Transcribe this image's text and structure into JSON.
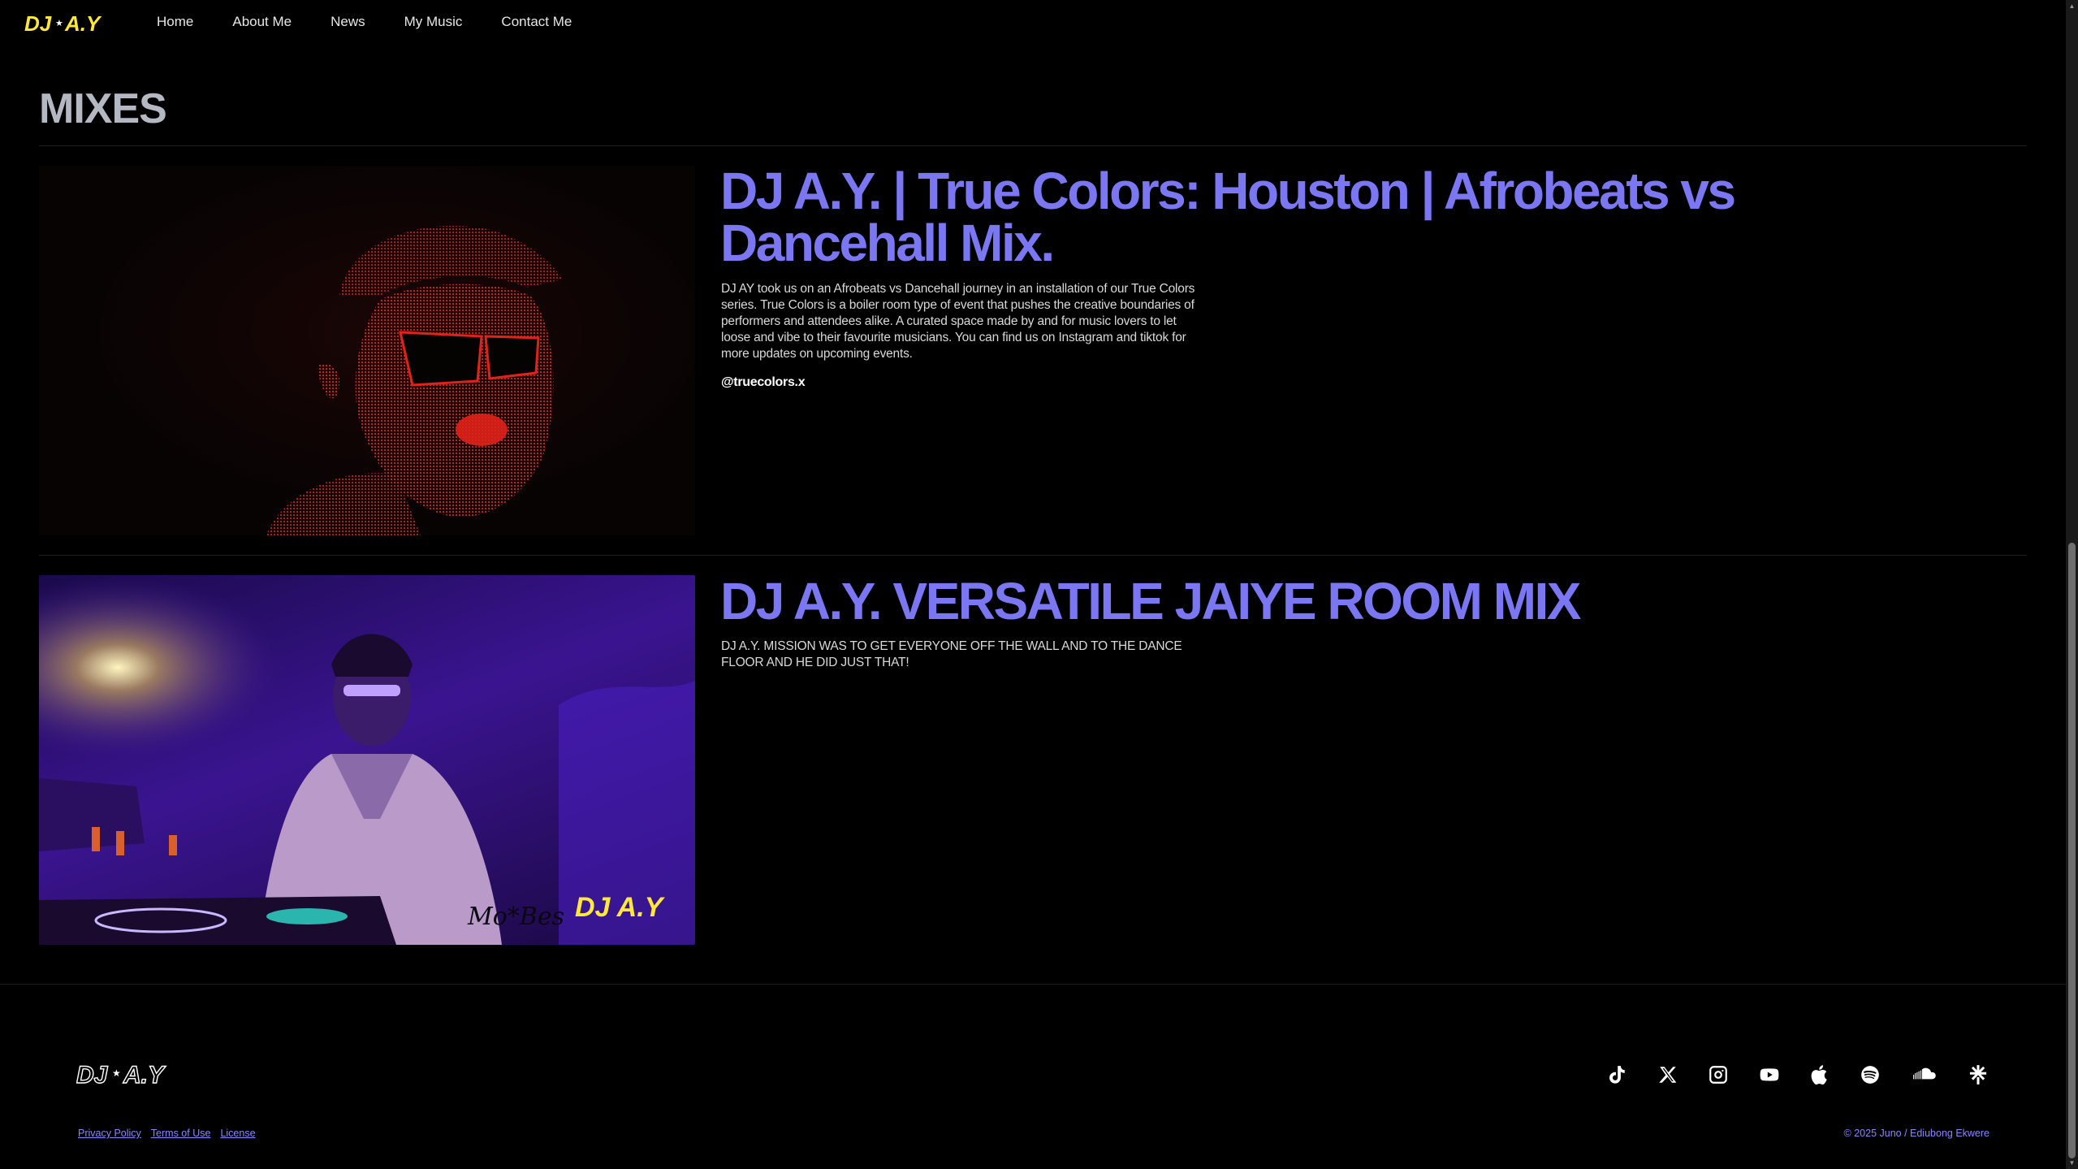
{
  "nav": {
    "logo_text": "DJ A.Y",
    "links": [
      "Home",
      "About Me",
      "News",
      "My Music",
      "Contact Me"
    ]
  },
  "section": {
    "title": "MIXES"
  },
  "mixes": [
    {
      "title": "DJ A.Y. | True Colors: Houston | Afrobeats vs Dancehall Mix.",
      "description": "DJ AY took us on an Afrobeats vs Dancehall journey in an installation of our True Colors series. True Colors is a boiler room type of event that pushes the creative boundaries of performers and attendees alike. A curated space made by and for music lovers to let loose and vibe to their favourite musicians. You can find us on Instagram and tiktok for more updates on upcoming events.",
      "handle": "@truecolors.x"
    },
    {
      "title": "DJ A.Y. VERSATILE JAIYE ROOM MIX",
      "description": "DJ A.Y. MISSION WAS TO GET EVERYONE OFF THE WALL AND TO THE DANCE FLOOR AND HE DID JUST THAT!",
      "watermark_left": "Mo*Bes",
      "watermark_right": "DJ A.Y"
    }
  ],
  "footer": {
    "logo_text": "DJ A.Y",
    "social_icons": [
      "tiktok-icon",
      "x-icon",
      "instagram-icon",
      "youtube-icon",
      "apple-icon",
      "spotify-icon",
      "soundcloud-icon",
      "linktree-icon"
    ],
    "legal": [
      "Privacy Policy",
      "Terms of Use",
      "License"
    ],
    "copyright": "© 2025 Juno / Ediubong Ekwere"
  },
  "colors": {
    "accent": "#7b77f3",
    "link": "#8a86ff",
    "logo_yellow": "#ffe83a",
    "background": "#000000"
  }
}
